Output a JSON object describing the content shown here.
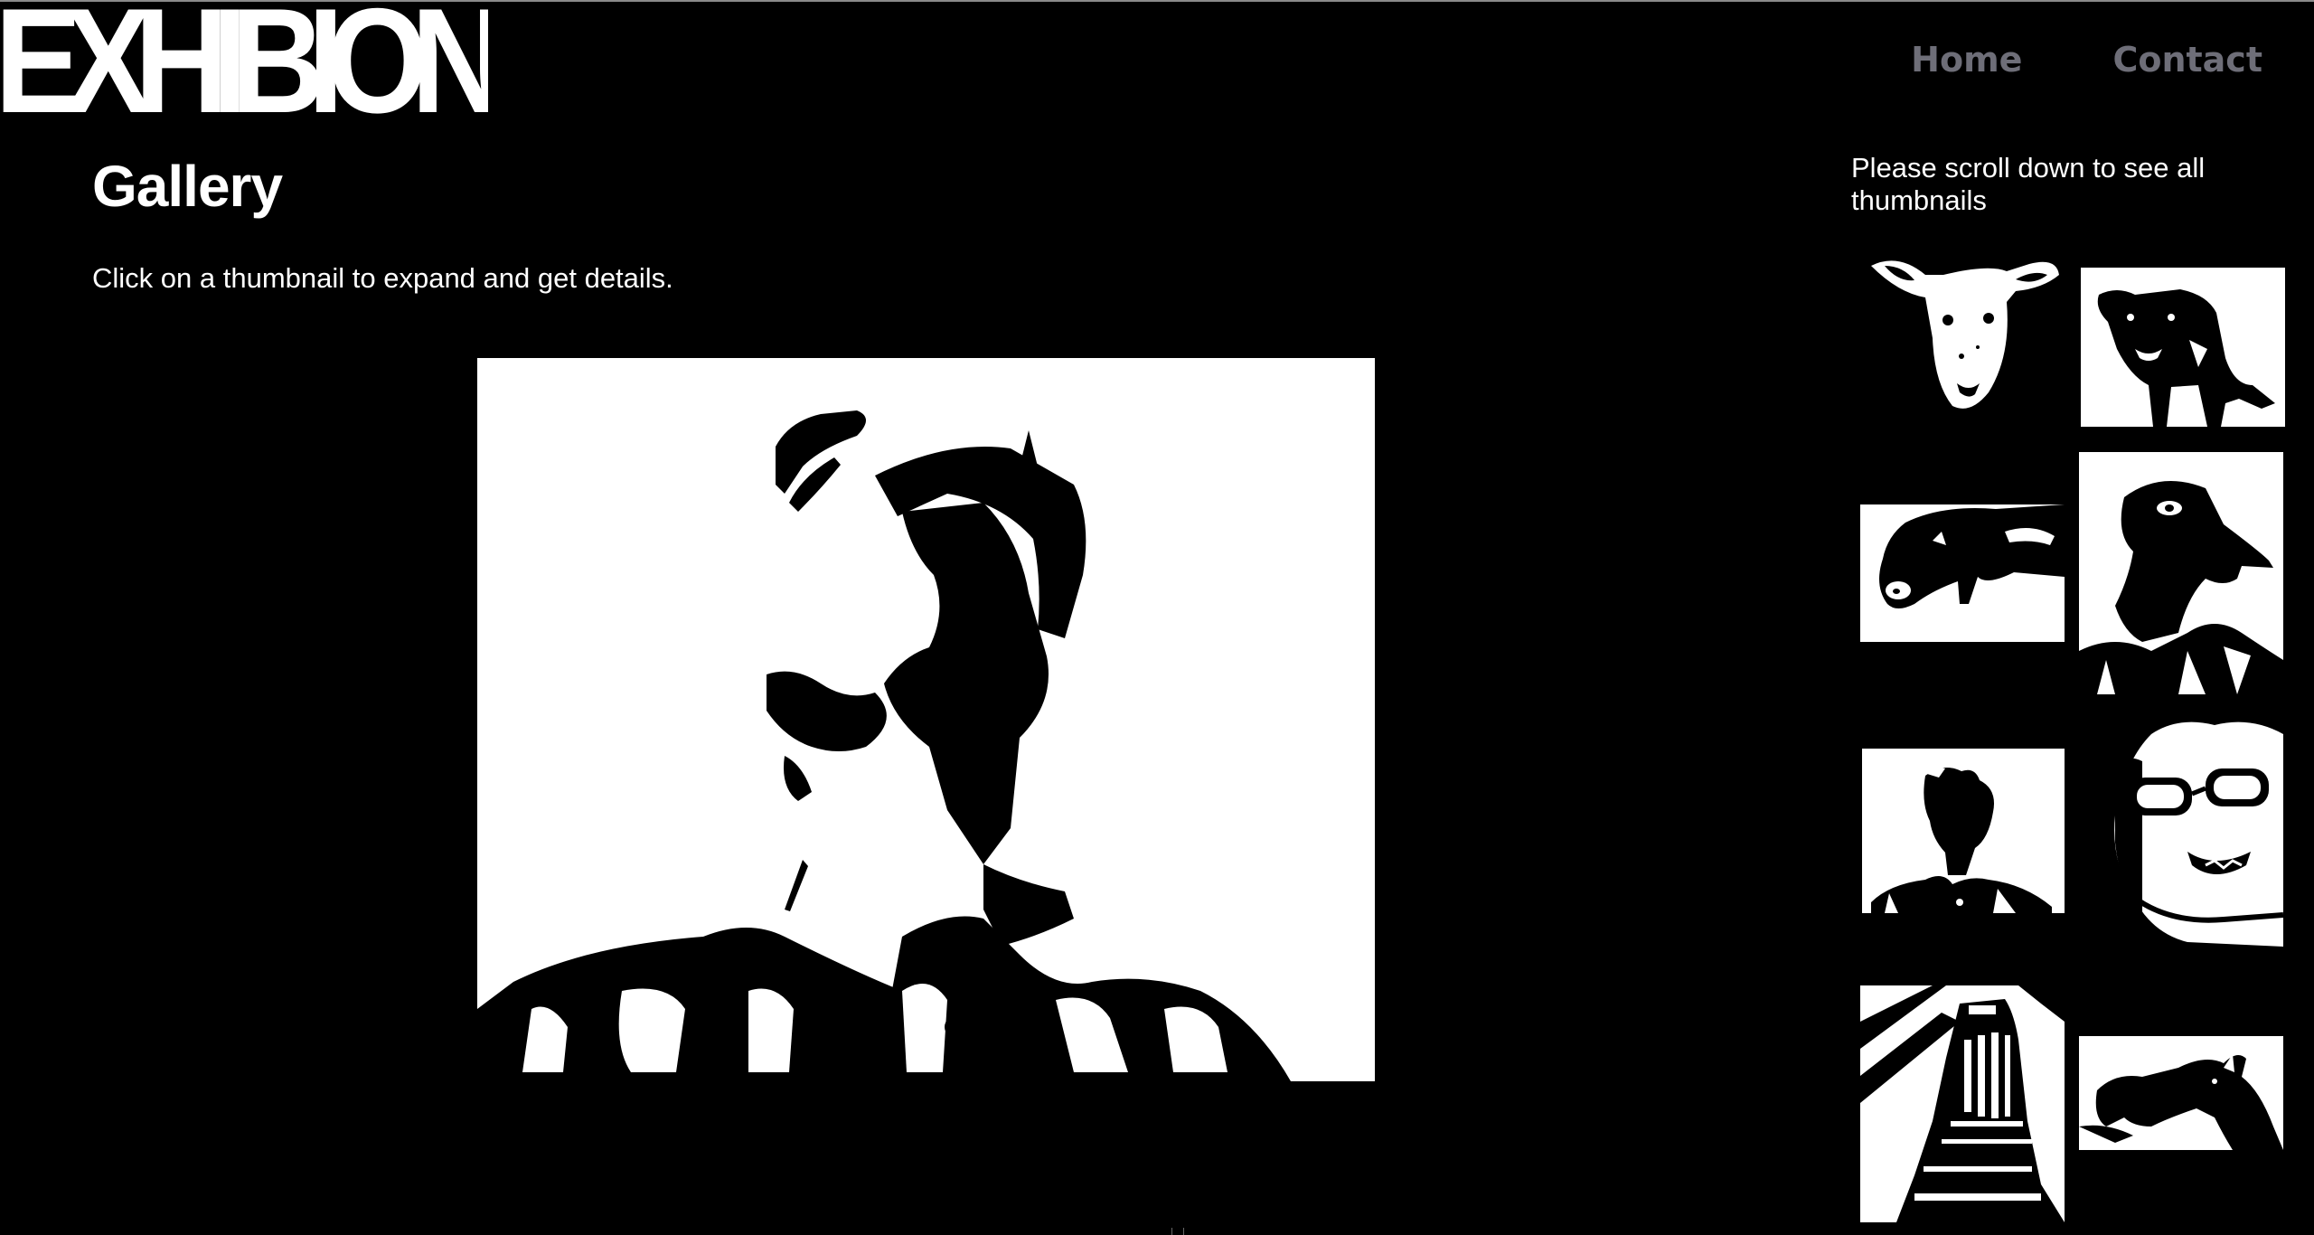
{
  "header": {
    "logo_text": "EXHIBION",
    "nav": [
      {
        "label": "Home"
      },
      {
        "label": "Contact"
      }
    ]
  },
  "main": {
    "title": "Gallery",
    "instruction": "Click on a thumbnail to expand and get details.",
    "preview_icon": "portrait-silhouette-image"
  },
  "sidebar": {
    "scroll_note": "Please scroll down to see all thumbnails",
    "thumbnails": [
      {
        "icon": "sheep-image"
      },
      {
        "icon": "bull-image"
      },
      {
        "icon": "pig-image"
      },
      {
        "icon": "pig-suit-image"
      },
      {
        "icon": "person-portrait-image"
      },
      {
        "icon": "goggles-face-image"
      },
      {
        "icon": "tower-image"
      },
      {
        "icon": "animal-image"
      }
    ]
  },
  "colors": {
    "background": "#000000",
    "text": "#ffffff",
    "nav_text": "#6e6e78"
  }
}
